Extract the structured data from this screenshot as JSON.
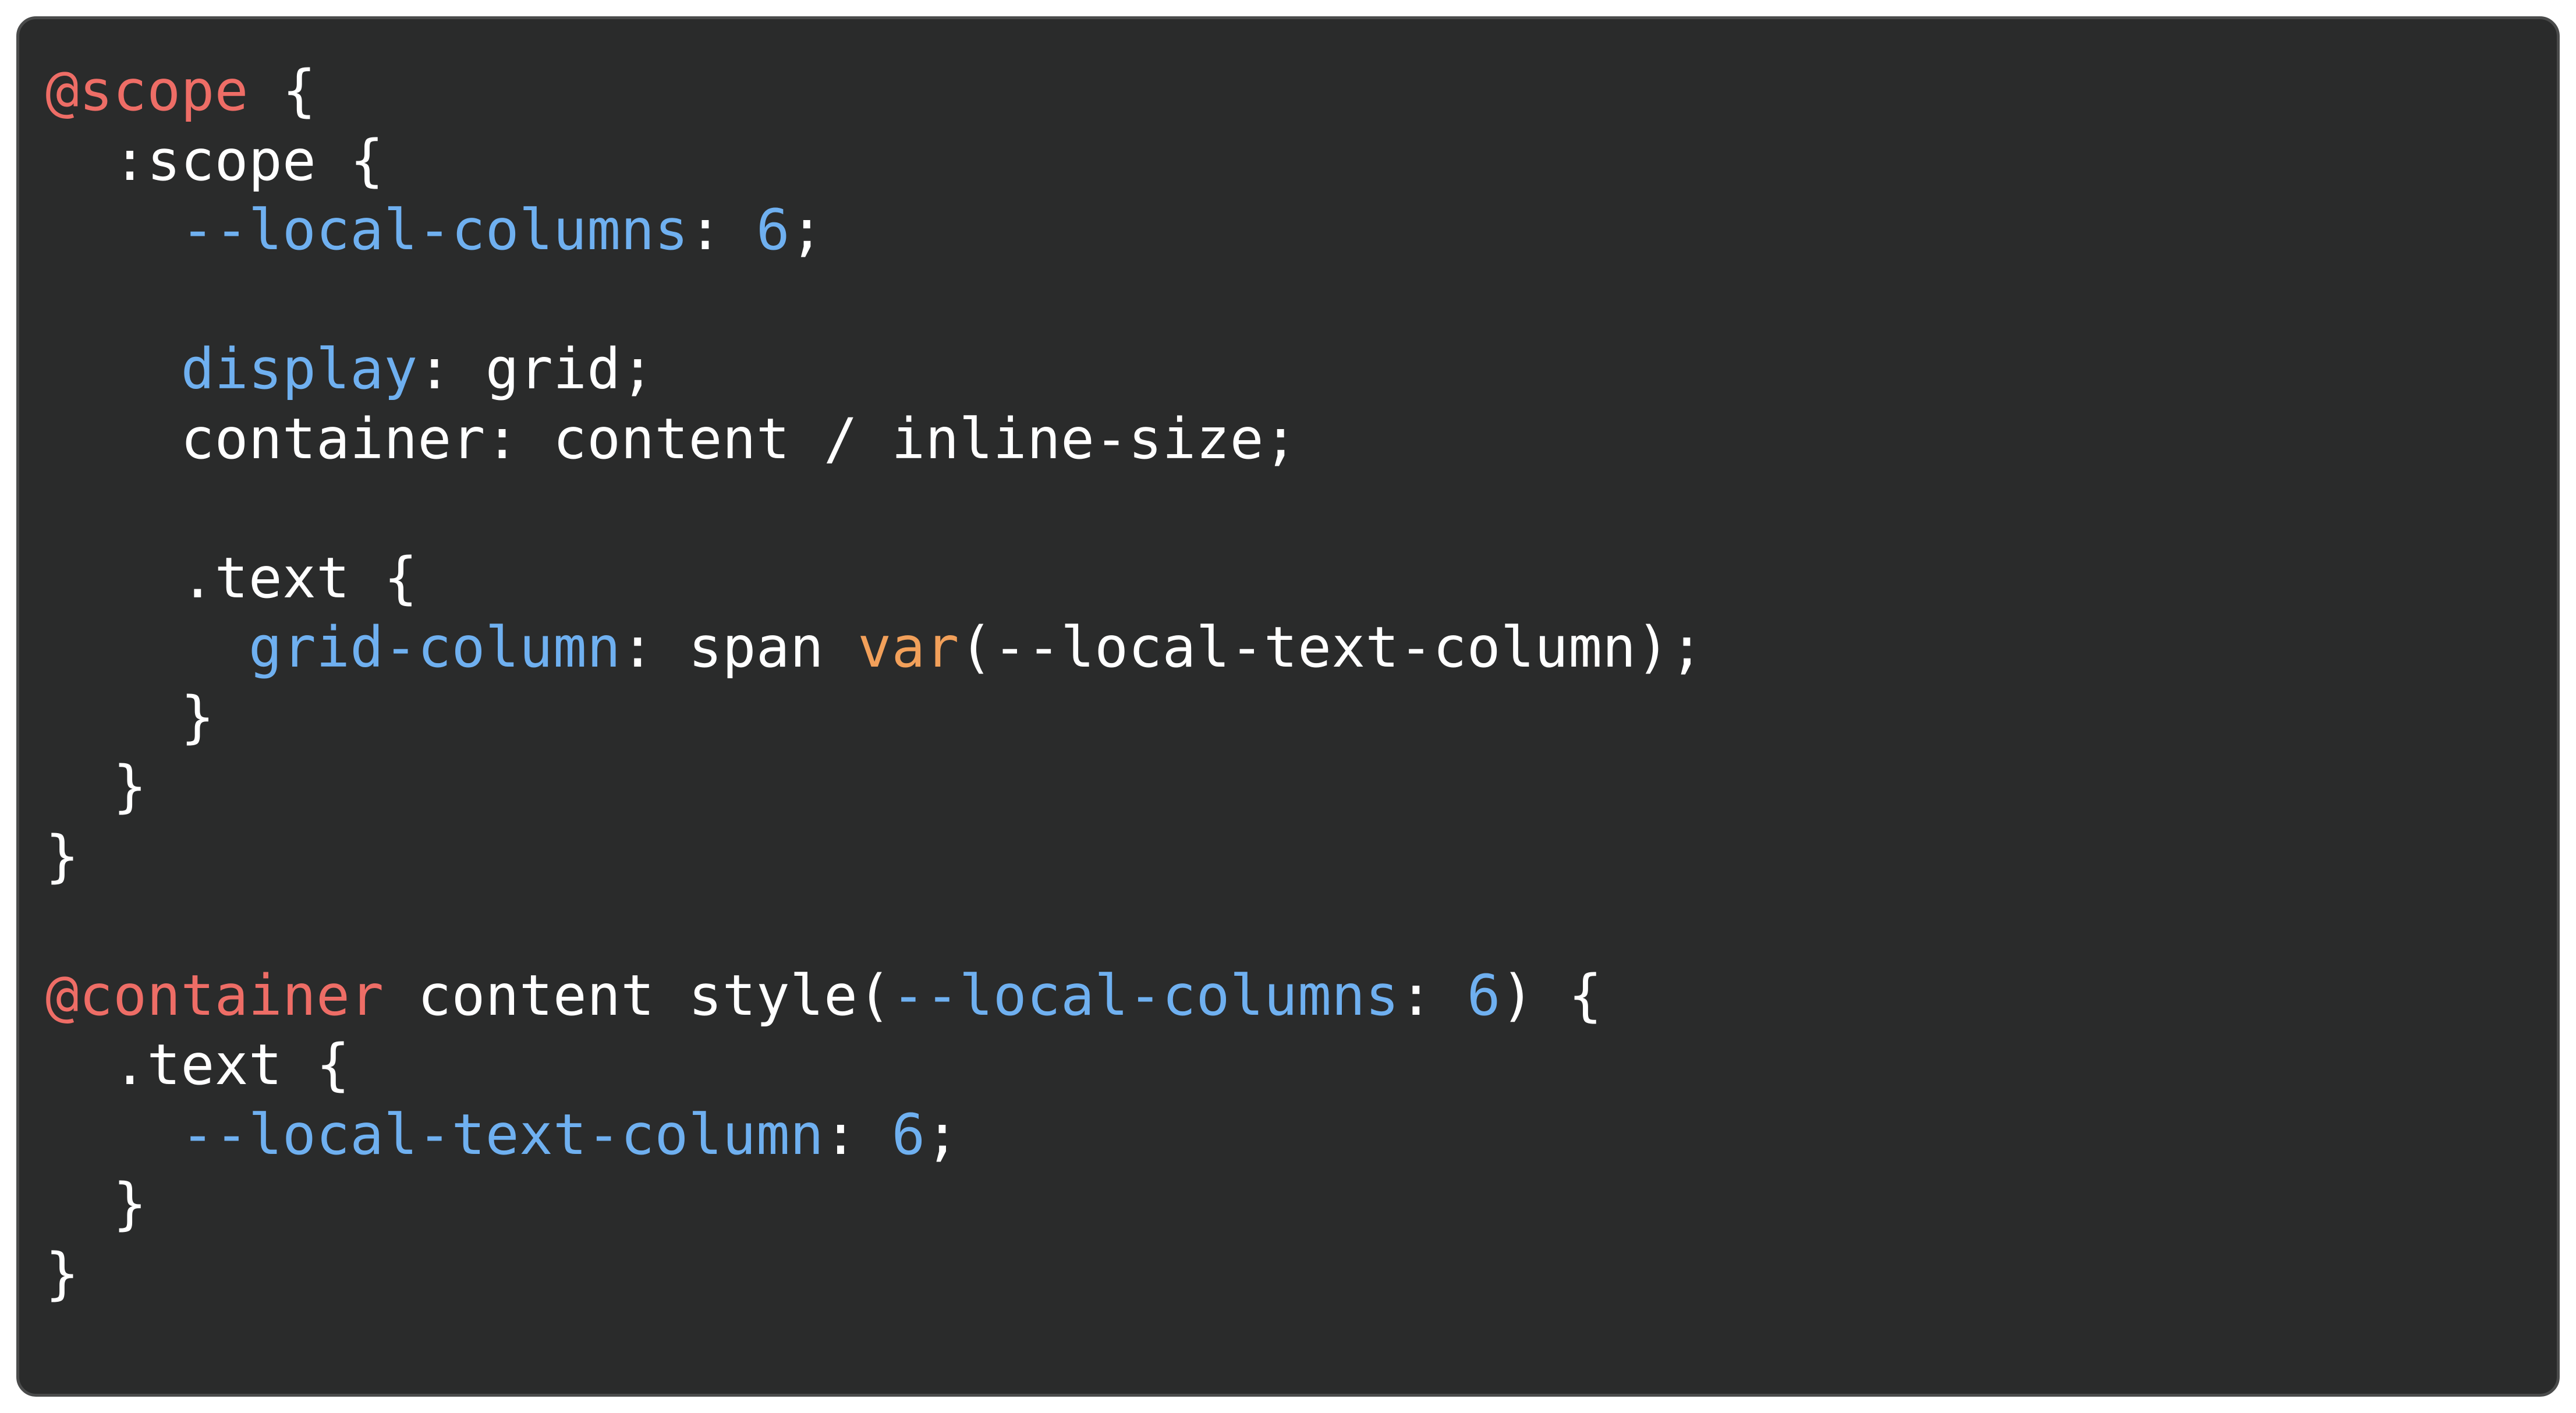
{
  "colors": {
    "background": "#2a2b2b",
    "border": "#4a4b4b",
    "at_rule": "#ee6d66",
    "property": "#6fb0f0",
    "number": "#6fb0f0",
    "function": "#f2a05a",
    "plain": "#ffffff"
  },
  "code": {
    "lines": [
      [
        {
          "t": "@scope",
          "k": "at"
        },
        {
          "t": " {",
          "k": "plain"
        }
      ],
      [
        {
          "t": "  :scope {",
          "k": "plain"
        }
      ],
      [
        {
          "t": "    ",
          "k": "plain"
        },
        {
          "t": "--local-columns",
          "k": "prop"
        },
        {
          "t": ": ",
          "k": "plain"
        },
        {
          "t": "6",
          "k": "num"
        },
        {
          "t": ";",
          "k": "plain"
        }
      ],
      [],
      [
        {
          "t": "    ",
          "k": "plain"
        },
        {
          "t": "display",
          "k": "prop"
        },
        {
          "t": ": grid;",
          "k": "plain"
        }
      ],
      [
        {
          "t": "    container: content / inline-size;",
          "k": "plain"
        }
      ],
      [],
      [
        {
          "t": "    .text {",
          "k": "plain"
        }
      ],
      [
        {
          "t": "      ",
          "k": "plain"
        },
        {
          "t": "grid-column",
          "k": "prop"
        },
        {
          "t": ": span ",
          "k": "plain"
        },
        {
          "t": "var",
          "k": "fn"
        },
        {
          "t": "(--local-text-column);",
          "k": "plain"
        }
      ],
      [
        {
          "t": "    }",
          "k": "plain"
        }
      ],
      [
        {
          "t": "  }",
          "k": "plain"
        }
      ],
      [
        {
          "t": "}",
          "k": "plain"
        }
      ],
      [],
      [
        {
          "t": "@container",
          "k": "at"
        },
        {
          "t": " content style(",
          "k": "plain"
        },
        {
          "t": "--local-columns",
          "k": "prop"
        },
        {
          "t": ": ",
          "k": "plain"
        },
        {
          "t": "6",
          "k": "num"
        },
        {
          "t": ") {",
          "k": "plain"
        }
      ],
      [
        {
          "t": "  .text {",
          "k": "plain"
        }
      ],
      [
        {
          "t": "    ",
          "k": "plain"
        },
        {
          "t": "--local-text-column",
          "k": "prop"
        },
        {
          "t": ": ",
          "k": "plain"
        },
        {
          "t": "6",
          "k": "num"
        },
        {
          "t": ";",
          "k": "plain"
        }
      ],
      [
        {
          "t": "  }",
          "k": "plain"
        }
      ],
      [
        {
          "t": "}",
          "k": "plain"
        }
      ]
    ]
  }
}
